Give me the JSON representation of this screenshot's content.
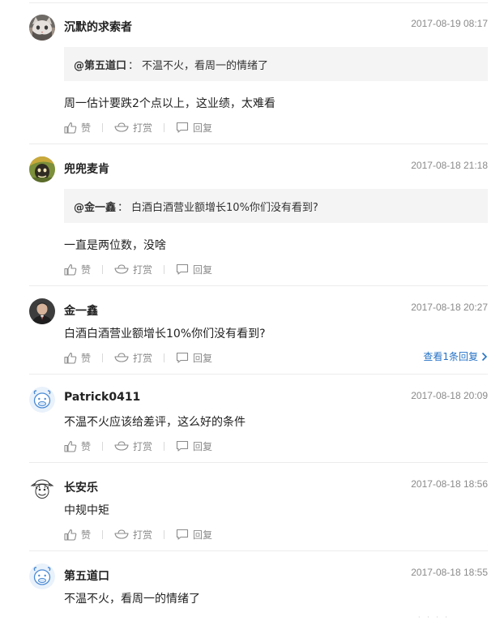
{
  "actions": {
    "like_label": "赞",
    "reward_label": "打赏",
    "reply_label": "回复"
  },
  "colors": {
    "link": "#2673c6",
    "muted": "#8a8a8a",
    "quote_bg": "#f4f4f4"
  },
  "comments": [
    {
      "username": "沉默的求索者",
      "time": "2017-08-19 08:17",
      "quote_author": "@第五道口",
      "quote_sep": "：",
      "quote_text": "不温不火，看周一的情绪了",
      "text": "周一估计要跌2个点以上，这业绩，太难看",
      "avatar_icon": "cat-avatar-icon"
    },
    {
      "username": "兜兜麦肯",
      "time": "2017-08-18 21:18",
      "quote_author": "@金一鑫",
      "quote_sep": "：",
      "quote_text": "白酒白酒营业额增长10%你们没有看到?",
      "text": "一直是两位数，没啥",
      "avatar_icon": "cartoon-avatar-icon"
    },
    {
      "username": "金一鑫",
      "time": "2017-08-18 20:27",
      "text": "白酒白酒营业额增长10%你们没有看到?",
      "view_replies": "查看1条回复",
      "avatar_icon": "man-portrait-avatar-icon"
    },
    {
      "username": "Patrick0411",
      "time": "2017-08-18 20:09",
      "text": "不温不火应该给差评，这么好的条件",
      "avatar_icon": "default-cow-avatar-icon"
    },
    {
      "username": "长安乐",
      "time": "2017-08-18 18:56",
      "text": "中规中矩",
      "avatar_icon": "luffy-sketch-avatar-icon"
    },
    {
      "username": "第五道口",
      "time": "2017-08-18 18:55",
      "text": "不温不火，看周一的情绪了",
      "avatar_icon": "default-cow-avatar-icon"
    }
  ]
}
